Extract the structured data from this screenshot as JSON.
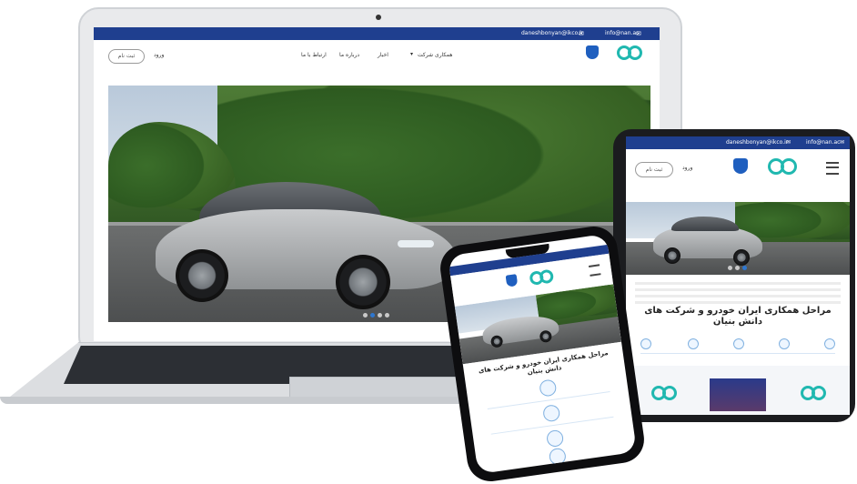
{
  "laptop": {
    "topbar": {
      "email_1": "daneshbonyan@ikco.ir",
      "email_2": "info@nan.ac"
    },
    "nav": {
      "login_label": "ورود",
      "signup_label": "ثبت نام",
      "menu": [
        "همکاری شرکت",
        "اخبار",
        "درباره ما",
        "ارتباط با ما"
      ]
    }
  },
  "tablet": {
    "topbar": {
      "email_1": "daneshbonyan@ikco.ir",
      "email_2": "info@nan.ac"
    },
    "nav": {
      "login_label": "ورود",
      "signup_label": "ثبت نام"
    },
    "heading": "مراحل همکاری ایران خودرو و شرکت های دانش بنیان"
  },
  "phone": {
    "heading": "مراحل همکاری ایران خودرو و شرکت های دانش بنیان"
  },
  "colors": {
    "brand_blue": "#1f3f8f",
    "teal": "#20b8b0",
    "active_dot": "#2e77d0"
  }
}
